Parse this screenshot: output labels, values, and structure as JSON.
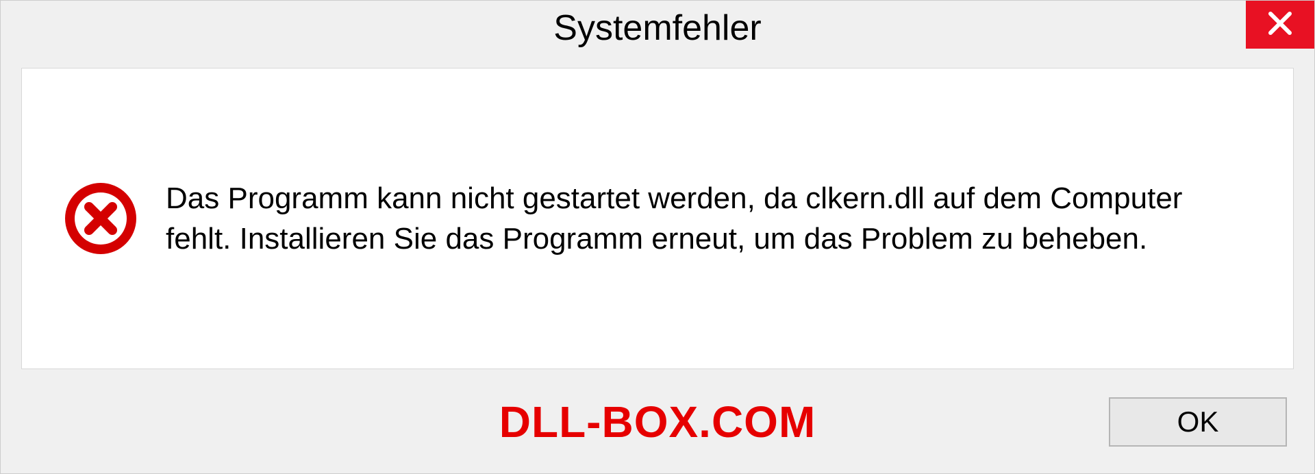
{
  "dialog": {
    "title": "Systemfehler",
    "message": "Das Programm kann nicht gestartet werden, da clkern.dll auf dem Computer fehlt. Installieren Sie das Programm erneut, um das Problem zu beheben.",
    "ok_label": "OK"
  },
  "watermark": "DLL-BOX.COM",
  "colors": {
    "close_button": "#e81123",
    "error_icon": "#d40000",
    "watermark": "#e60000"
  }
}
